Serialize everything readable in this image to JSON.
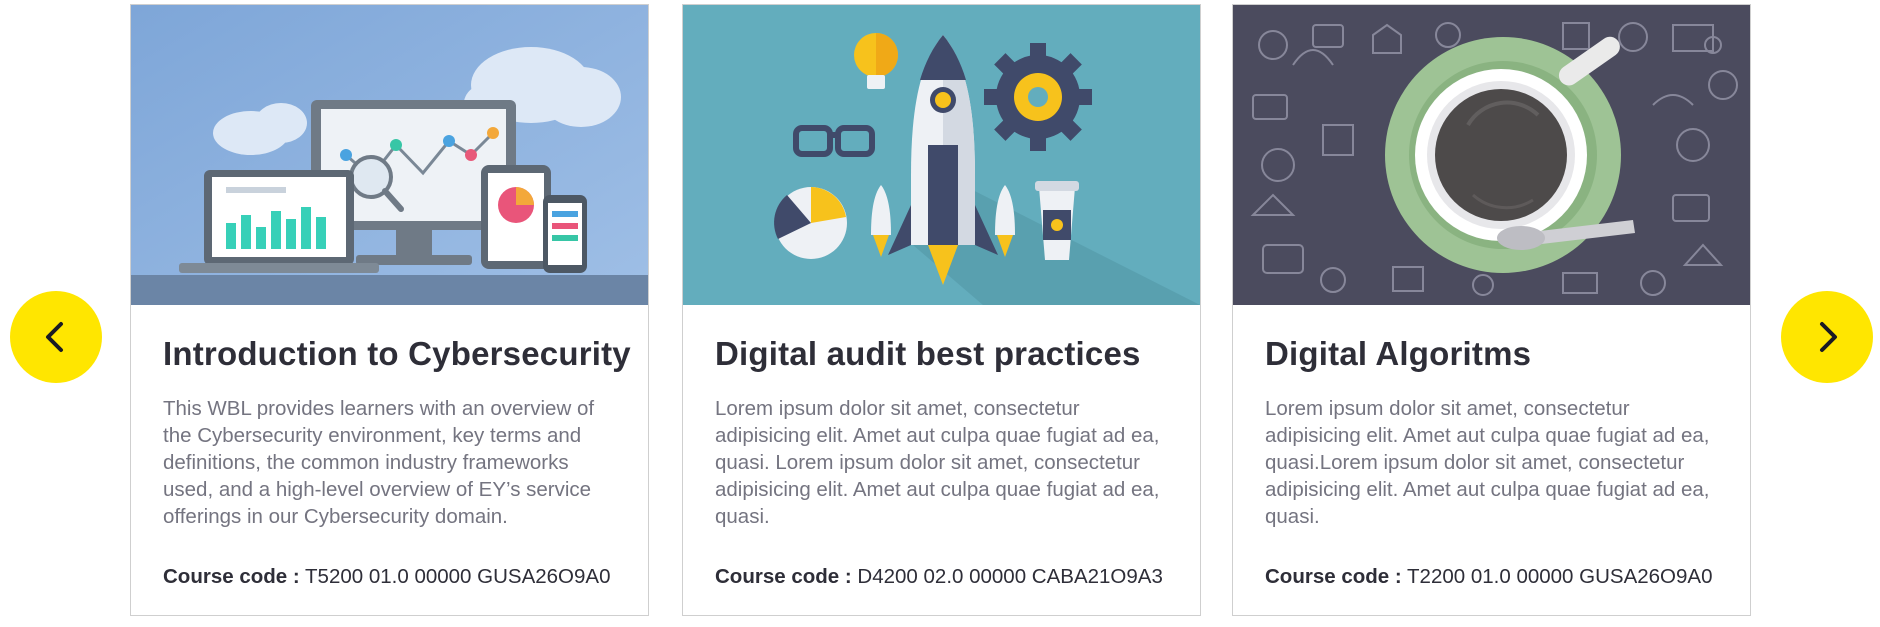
{
  "carousel": {
    "prev_icon": "chevron-left-icon",
    "next_icon": "chevron-right-icon",
    "accent_color": "#ffe600",
    "cards": [
      {
        "title": "Introduction to Cybersecurity",
        "description": "This WBL provides learners with an overview of the Cybersecurity environment, key terms and definitions, the common industry frameworks used, and a high-level overview of EY’s service offerings in our Cybersecurity domain.",
        "code_label": "Course code :",
        "code_value": "T5200 01.0 00000 GUSA26O9A0",
        "image": "devices-analytics-illustration"
      },
      {
        "title": "Digital audit best practices",
        "description": "Lorem ipsum dolor sit amet, consectetur adipisicing elit. Amet aut culpa quae fugiat ad ea, quasi. Lorem ipsum dolor sit amet, consectetur adipisicing elit. Amet aut culpa quae fugiat ad ea, quasi.",
        "code_label": "Course code :",
        "code_value": "D4200 02.0 00000 CABA21O9A3",
        "image": "rocket-launch-illustration"
      },
      {
        "title": "Digital Algoritms",
        "description": "Lorem ipsum dolor sit amet, consectetur adipisicing elit. Amet aut culpa quae fugiat ad ea, quasi.Lorem ipsum dolor sit amet, consectetur adipisicing elit. Amet aut culpa quae fugiat ad ea, quasi.",
        "code_label": "Course code :",
        "code_value": "T2200 01.0 00000 GUSA26O9A0",
        "image": "coffee-cup-doodles-illustration"
      }
    ]
  }
}
